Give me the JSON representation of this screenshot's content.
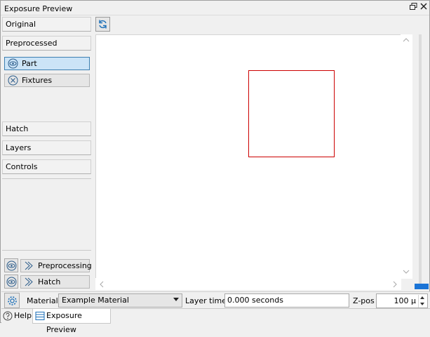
{
  "window": {
    "title": "Exposure Preview",
    "restore_icon": "restore-window-icon",
    "close_icon": "close-icon"
  },
  "sidebar": {
    "sections": [
      {
        "label": "Original"
      },
      {
        "label": "Preprocessed"
      }
    ],
    "preprocessed_items": [
      {
        "label": "Part",
        "icon": "eye-icon",
        "active": true
      },
      {
        "label": "Fixtures",
        "icon": "circle-x-icon",
        "active": false
      }
    ],
    "lower_sections": [
      {
        "label": "Hatch"
      },
      {
        "label": "Layers"
      },
      {
        "label": "Controls"
      }
    ],
    "stage_rows": [
      {
        "label": "Preprocessing",
        "visibility_icon": "eye-icon",
        "stage_icon": "double-chevron-icon"
      },
      {
        "label": "Hatch",
        "visibility_icon": "eye-icon",
        "stage_icon": "double-chevron-icon"
      }
    ]
  },
  "toolbar": {
    "refresh_icon": "refresh-icon"
  },
  "preview": {
    "shapes": [
      {
        "type": "rectangle",
        "color": "#cc0000",
        "label": "part outline"
      }
    ]
  },
  "layer_slider": {
    "position_fraction": 0.0,
    "handle_color": "#1b74d6"
  },
  "statusbar": {
    "settings_icon": "gear-icon",
    "material_label": "Material",
    "material_value": "Example Material",
    "layer_time_label": "Layer time",
    "layer_time_value": "0.000 seconds",
    "zpos_label": "Z-pos",
    "zpos_value": "100 µ"
  },
  "tabs": [
    {
      "label": "Help",
      "icon": "help-icon",
      "active": false
    },
    {
      "label": "Exposure Preview",
      "icon": "list-icon",
      "active": true
    }
  ]
}
